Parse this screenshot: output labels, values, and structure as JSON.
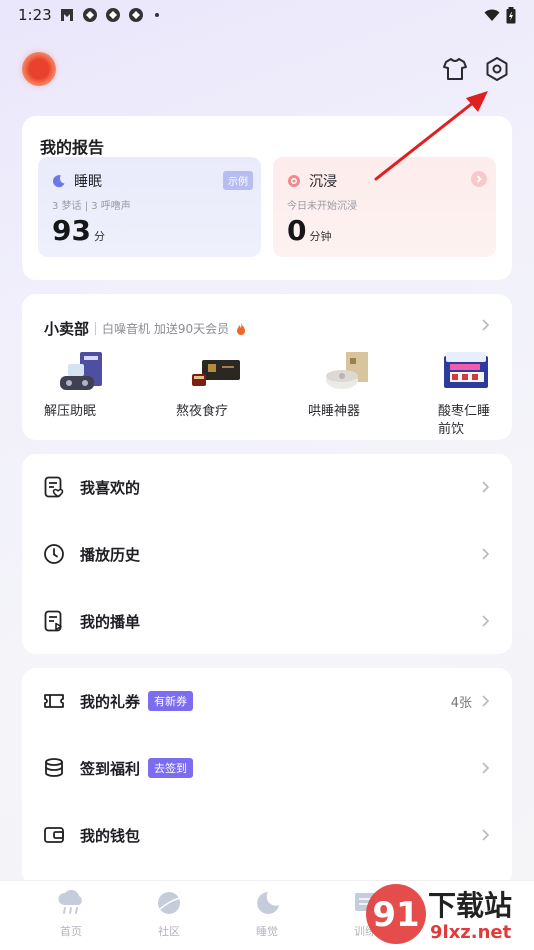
{
  "status_bar": {
    "time": "1:23"
  },
  "report": {
    "title": "我的报告",
    "sleep": {
      "label": "睡眠",
      "badge": "示例",
      "sub": "3 梦话 | 3 呼噜声",
      "value": "93",
      "unit": "分"
    },
    "immerse": {
      "label": "沉浸",
      "sub": "今日未开始沉浸",
      "value": "0",
      "unit": "分钟"
    }
  },
  "shop": {
    "title": "小卖部",
    "promo": "白噪音机 加送90天会员",
    "items": [
      {
        "label": "解压助眠"
      },
      {
        "label": "熬夜食疗"
      },
      {
        "label": "哄睡神器"
      },
      {
        "label": "酸枣仁睡前饮"
      }
    ]
  },
  "list1": [
    {
      "label": "我喜欢的",
      "icon": "favorites-list-icon"
    },
    {
      "label": "播放历史",
      "icon": "clock-icon"
    },
    {
      "label": "我的播单",
      "icon": "playlist-icon"
    }
  ],
  "list2": [
    {
      "label": "我的礼券",
      "badge": "有新券",
      "right": "4张",
      "icon": "ticket-icon"
    },
    {
      "label": "签到福利",
      "badge": "去签到",
      "icon": "coins-icon"
    },
    {
      "label": "我的钱包",
      "icon": "wallet-icon"
    }
  ],
  "tabs": [
    {
      "label": "首页",
      "icon": "cloud-rain-icon"
    },
    {
      "label": "社区",
      "icon": "planet-icon"
    },
    {
      "label": "睡觉",
      "icon": "moon-icon"
    },
    {
      "label": "训练",
      "icon": "training-icon"
    }
  ],
  "watermark": {
    "text": "下载站",
    "domain": "9lxz.net"
  },
  "colors": {
    "accent": "#7c6cf0",
    "annotation_arrow": "#e02020"
  }
}
